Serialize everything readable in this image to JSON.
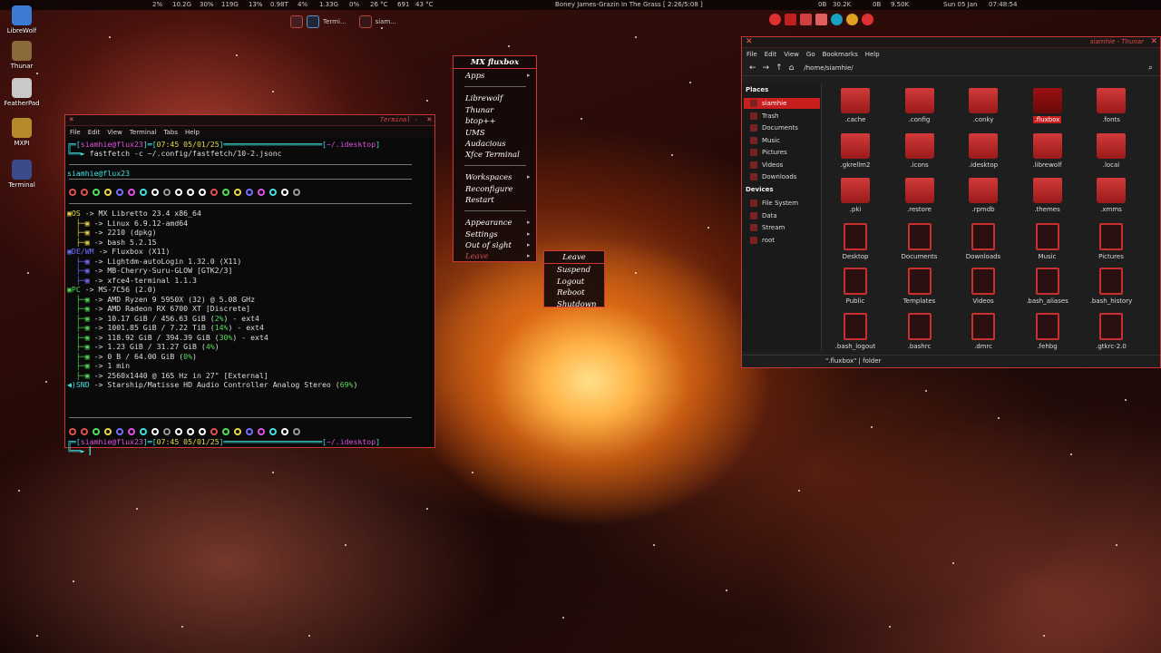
{
  "panel": {
    "stats": [
      "2%",
      "10.2G",
      "30%",
      "119G",
      "13%",
      "0.98T",
      "4%",
      "1.33G",
      "0%",
      "26 °C",
      "691",
      "43 °C"
    ],
    "now_playing": "Boney James-Grazin In The Grass  [ 2:26/5:08 ]",
    "net": [
      "0B",
      "30.2K",
      "0B",
      "9.50K"
    ],
    "date": "Sun 05 Jan",
    "time": "07:48:54"
  },
  "taskbar": [
    {
      "label": "Termi..."
    },
    {
      "label": "siam..."
    }
  ],
  "desktop_icons": [
    {
      "label": "LibreWolf",
      "color": "#3b7bd6"
    },
    {
      "label": "Thunar",
      "color": "#8a6a3a"
    },
    {
      "label": "FeatherPad",
      "color": "#c9c9c9"
    },
    {
      "label": "MXPI",
      "color": "#b58a2a"
    },
    {
      "label": "Terminal",
      "color": "#3a4a8a"
    }
  ],
  "terminal": {
    "title": "Terminal -",
    "menu": [
      "File",
      "Edit",
      "View",
      "Terminal",
      "Tabs",
      "Help"
    ],
    "prompt_user": "siamhie@flux23",
    "prompt_time": "07:45 05/01/25",
    "prompt_dir": "~/.idesktop",
    "command": "fastfetch -c ~/.config/fastfetch/10-2.jsonc",
    "user_host": "siamhie@flux23",
    "lines": [
      {
        "key": "OS",
        "text": "-> MX Libretto 23.4 x86_64"
      },
      {
        "key": "",
        "text": "-> Linux 6.9.12-amd64"
      },
      {
        "key": "",
        "text": "-> 2210 (dpkg)"
      },
      {
        "key": "",
        "text": "-> bash 5.2.15"
      },
      {
        "key": "DE/WM",
        "text": "-> Fluxbox (X11)"
      },
      {
        "key": "",
        "text": "-> Lightdm-autoLogin 1.32.0 (X11)"
      },
      {
        "key": "",
        "text": "-> MB-Cherry-Suru-GLOW [GTK2/3]"
      },
      {
        "key": "",
        "text": "-> xfce4-terminal 1.1.3"
      },
      {
        "key": "PC",
        "text": "-> MS-7C56 (2.0)"
      },
      {
        "key": "",
        "text": "-> AMD Ryzen 9 5950X (32) @ 5.08 GHz"
      },
      {
        "key": "",
        "text": "-> AMD Radeon RX 6700 XT [Discrete]"
      },
      {
        "key": "",
        "text": "-> 10.17 GiB / 456.63 GiB (2%) - ext4"
      },
      {
        "key": "",
        "text": "-> 1001.85 GiB / 7.22 TiB (14%) - ext4"
      },
      {
        "key": "",
        "text": "-> 118.92 GiB / 394.39 GiB (30%) - ext4"
      },
      {
        "key": "",
        "text": "-> 1.23 GiB / 31.27 GiB (4%)"
      },
      {
        "key": "",
        "text": "-> 0 B / 64.00 GiB (0%)"
      },
      {
        "key": "",
        "text": "-> 1 min"
      },
      {
        "key": "",
        "text": "-> 2560x1440 @ 165 Hz in 27\" [External]"
      },
      {
        "key": "SND",
        "text": "-> Starship/Matisse HD Audio Controller Analog Stereo (69%)"
      }
    ],
    "dot_colors": [
      "#e05050",
      "#e05050",
      "#55dd55",
      "#e8d84a",
      "#7070ff",
      "#e050e0",
      "#41e0e0",
      "#ffffff",
      "#999999",
      "#ffffff",
      "#ffffff",
      "#ffffff",
      "#e05050",
      "#55dd55",
      "#e8d84a",
      "#7070ff",
      "#e050e0",
      "#41e0e0",
      "#ffffff",
      "#999999"
    ]
  },
  "fluxbox_menu": {
    "title": "MX fluxbox",
    "items": [
      {
        "label": "Apps",
        "arrow": true
      },
      {
        "label": "Librewolf"
      },
      {
        "label": "Thunar"
      },
      {
        "label": "btop++"
      },
      {
        "label": "UMS"
      },
      {
        "label": "Audacious"
      },
      {
        "label": "Xfce Terminal"
      },
      {
        "label": "Workspaces",
        "arrow": true
      },
      {
        "label": "Reconfigure"
      },
      {
        "label": "Restart"
      },
      {
        "label": "Appearance",
        "arrow": true
      },
      {
        "label": "Settings",
        "arrow": true
      },
      {
        "label": "Out of sight",
        "arrow": true
      },
      {
        "label": "Leave",
        "arrow": true
      }
    ],
    "submenu_title": "Leave",
    "submenu": [
      "Suspend",
      "Logout",
      "Reboot",
      "Shutdown"
    ]
  },
  "thunar": {
    "title": "siamhie - Thunar",
    "menu": [
      "File",
      "Edit",
      "View",
      "Go",
      "Bookmarks",
      "Help"
    ],
    "path": "/home/siamhie/",
    "places_header": "Places",
    "places": [
      "siamhie",
      "Trash",
      "Documents",
      "Music",
      "Pictures",
      "Videos",
      "Downloads"
    ],
    "devices_header": "Devices",
    "devices": [
      "File System",
      "Data",
      "Stream",
      "root"
    ],
    "files": [
      {
        "name": ".cache",
        "kind": "folder"
      },
      {
        "name": ".config",
        "kind": "folder"
      },
      {
        "name": ".conky",
        "kind": "folder"
      },
      {
        "name": ".fluxbox",
        "kind": "folder-sel"
      },
      {
        "name": ".fonts",
        "kind": "folder"
      },
      {
        "name": ".gkrellm2",
        "kind": "folder"
      },
      {
        "name": ".icons",
        "kind": "folder"
      },
      {
        "name": ".idesktop",
        "kind": "folder"
      },
      {
        "name": ".librewolf",
        "kind": "folder"
      },
      {
        "name": ".local",
        "kind": "folder"
      },
      {
        "name": ".pki",
        "kind": "folder"
      },
      {
        "name": ".restore",
        "kind": "folder"
      },
      {
        "name": ".rpmdb",
        "kind": "folder"
      },
      {
        "name": ".themes",
        "kind": "folder"
      },
      {
        "name": ".xmms",
        "kind": "folder"
      },
      {
        "name": "Desktop",
        "kind": "doc"
      },
      {
        "name": "Documents",
        "kind": "doc"
      },
      {
        "name": "Downloads",
        "kind": "doc"
      },
      {
        "name": "Music",
        "kind": "doc"
      },
      {
        "name": "Pictures",
        "kind": "doc"
      },
      {
        "name": "Public",
        "kind": "doc"
      },
      {
        "name": "Templates",
        "kind": "doc"
      },
      {
        "name": "Videos",
        "kind": "doc"
      },
      {
        "name": ".bash_aliases",
        "kind": "doc"
      },
      {
        "name": ".bash_history",
        "kind": "doc"
      },
      {
        "name": ".bash_logout",
        "kind": "doc"
      },
      {
        "name": ".bashrc",
        "kind": "doc"
      },
      {
        "name": ".dmrc",
        "kind": "doc"
      },
      {
        "name": ".fehbg",
        "kind": "doc"
      },
      {
        "name": ".gtkrc-2.0",
        "kind": "doc"
      }
    ],
    "status": "\".fluxbox\"  |  folder"
  }
}
